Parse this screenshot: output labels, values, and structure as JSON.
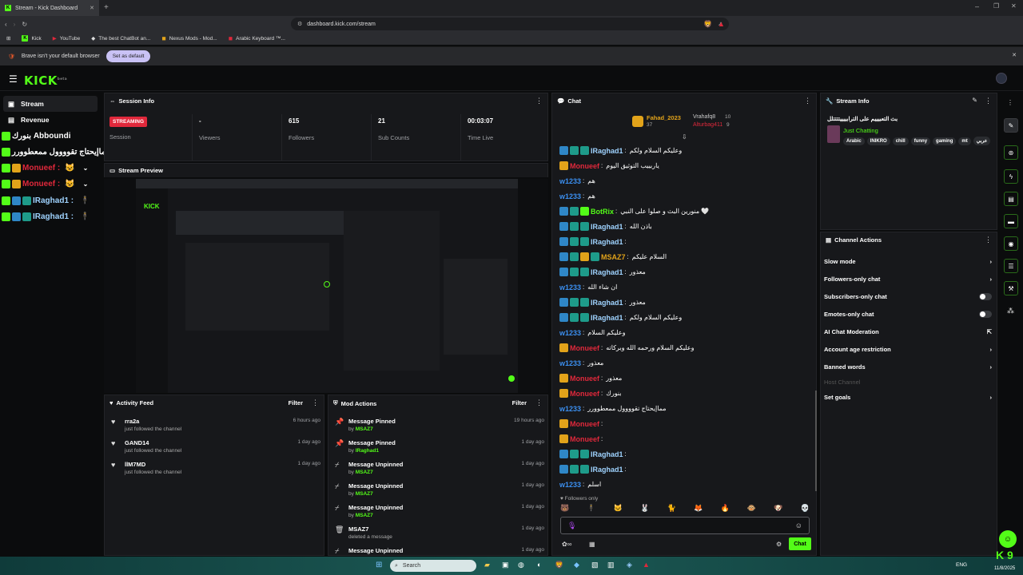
{
  "browser": {
    "tab_title": "Stream - Kick Dashboard",
    "url": "dashboard.kick.com/stream",
    "bookmarks": [
      "Kick",
      "YouTube",
      "The best ChatBot an...",
      "Nexus Mods - Mod...",
      "Arabic Keyboard ™..."
    ],
    "notice_text": "Brave isn't your default browser",
    "notice_button": "Set as default"
  },
  "header": {
    "logo": "KICK",
    "logo_sup": "beta"
  },
  "sidebar": {
    "items": [
      {
        "label": "Stream"
      },
      {
        "label": "Revenue"
      }
    ],
    "overlay_lines": [
      {
        "text": "بنورك Abboundi",
        "color": "#ffffff"
      },
      {
        "text": "مماإيحتاج تقوووول ممعطوورر : w1233",
        "color": "#ffffff"
      },
      {
        "text": "Monueef :",
        "color": "#e0283b"
      },
      {
        "text": "Monueef :",
        "color": "#e0283b"
      },
      {
        "text": "IRaghad1 :",
        "color": "#9fd3ff"
      },
      {
        "text": "IRaghad1 :",
        "color": "#9fd3ff"
      }
    ]
  },
  "session": {
    "title": "Session Info",
    "status": "STREAMING",
    "stats": [
      {
        "value": "",
        "label": "Session"
      },
      {
        "value": "-",
        "label": "Viewers"
      },
      {
        "value": "615",
        "label": "Followers"
      },
      {
        "value": "21",
        "label": "Sub Counts"
      },
      {
        "value": "00:03:07",
        "label": "Time Live"
      }
    ]
  },
  "preview": {
    "title": "Stream Preview"
  },
  "activity": {
    "title": "Activity Feed",
    "filter": "Filter",
    "items": [
      {
        "name": "rra2a",
        "desc": "just followed the channel",
        "time": "6 hours ago"
      },
      {
        "name": "GAND14",
        "desc": "just followed the channel",
        "time": "1 day ago"
      },
      {
        "name": "llM7MD",
        "desc": "just followed the channel",
        "time": "1 day ago"
      }
    ]
  },
  "mod_actions": {
    "title": "Mod Actions",
    "filter": "Filter",
    "items": [
      {
        "action": "Message Pinned",
        "by": "by",
        "user": "MSAZ7",
        "time": "19 hours ago",
        "icon": "pin-icon"
      },
      {
        "action": "Message Pinned",
        "by": "by",
        "user": "IRaghad1",
        "time": "1 day ago",
        "icon": "pin-icon"
      },
      {
        "action": "Message Unpinned",
        "by": "by",
        "user": "MSAZ7",
        "time": "1 day ago",
        "icon": "unpin-icon"
      },
      {
        "action": "Message Unpinned",
        "by": "by",
        "user": "MSAZ7",
        "time": "1 day ago",
        "icon": "unpin-icon"
      },
      {
        "action": "Message Unpinned",
        "by": "by",
        "user": "MSAZ7",
        "time": "1 day ago",
        "icon": "unpin-icon"
      },
      {
        "action": "MSAZ7",
        "by": "deleted a message",
        "user": "",
        "time": "1 day ago",
        "icon": "trash-icon"
      },
      {
        "action": "Message Unpinned",
        "by": "",
        "user": "",
        "time": "1 day ago",
        "icon": "unpin-icon"
      }
    ]
  },
  "chat": {
    "title": "Chat",
    "top_users": [
      {
        "name": "Fahad_2023",
        "count": "37"
      },
      {
        "name": "Vrahafq8",
        "count": "10"
      },
      {
        "name": "Alturbag411",
        "count": "9"
      }
    ],
    "messages": [
      {
        "user": "IRaghad1",
        "cls": "u-raghad",
        "text": "وعليكم السلام ولكم",
        "badges": "3"
      },
      {
        "user": "Monueef",
        "cls": "u-monu",
        "text": "ياربييب التوثيق اليوم",
        "badges": "1"
      },
      {
        "user": "w1233",
        "cls": "u-w",
        "text": "هم",
        "badges": "0"
      },
      {
        "user": "w1233",
        "cls": "u-w",
        "text": "هم",
        "badges": "0"
      },
      {
        "user": "BotRix",
        "cls": "u-botrix",
        "text": "منورين البث و صلوا على النبي 🤍",
        "badges": "2"
      },
      {
        "user": "IRaghad1",
        "cls": "u-raghad",
        "text": "باذن الله",
        "badges": "3"
      },
      {
        "user": "IRaghad1",
        "cls": "u-raghad",
        "text": "",
        "badges": "3"
      },
      {
        "user": "MSAZ7",
        "cls": "u-msaz",
        "text": "السلام عليكم",
        "badges": "4"
      },
      {
        "user": "IRaghad1",
        "cls": "u-raghad",
        "text": "معذور",
        "badges": "3"
      },
      {
        "user": "w1233",
        "cls": "u-w",
        "text": "ان شاء الله",
        "badges": "0"
      },
      {
        "user": "IRaghad1",
        "cls": "u-raghad",
        "text": "معذور",
        "badges": "3"
      },
      {
        "user": "IRaghad1",
        "cls": "u-raghad",
        "text": "وعليكم السلام ولكم",
        "badges": "3"
      },
      {
        "user": "w1233",
        "cls": "u-w",
        "text": "وعليكم السلام",
        "badges": "0"
      },
      {
        "user": "Monueef",
        "cls": "u-monu",
        "text": "وعليكم السلام ورحمه الله وبركاته",
        "badges": "1"
      },
      {
        "user": "w1233",
        "cls": "u-w",
        "text": "معذور",
        "badges": "0"
      },
      {
        "user": "Monueef",
        "cls": "u-monu",
        "text": "معذور",
        "badges": "1"
      },
      {
        "user": "Monueef",
        "cls": "u-monu",
        "text": "بنورك",
        "badges": "1"
      },
      {
        "user": "w1233",
        "cls": "u-w",
        "text": "مماإيحتاج تقوووول ممعطوورر",
        "badges": "0"
      },
      {
        "user": "Monueef",
        "cls": "u-monu",
        "text": "",
        "badges": "1"
      },
      {
        "user": "Monueef",
        "cls": "u-monu",
        "text": "",
        "badges": "1"
      },
      {
        "user": "IRaghad1",
        "cls": "u-raghad",
        "text": "",
        "badges": "3"
      },
      {
        "user": "IRaghad1",
        "cls": "u-raghad",
        "text": "",
        "badges": "3"
      },
      {
        "user": "w1233",
        "cls": "u-w",
        "text": "اسلم",
        "badges": "0"
      }
    ],
    "followers_only": "Followers only",
    "send_label": "Chat"
  },
  "stream_info": {
    "title": "Stream Info",
    "stream_title": "بث التعبيييم على الترابييييتتتتلل",
    "category": "Just Chatting",
    "tags": [
      "Arabic",
      "INIKRO",
      "chill",
      "funny",
      "gaming",
      "mt",
      "عربي"
    ]
  },
  "channel_actions": {
    "title": "Channel Actions",
    "items": [
      {
        "label": "Slow mode",
        "control": "chevron"
      },
      {
        "label": "Followers-only chat",
        "control": "chevron"
      },
      {
        "label": "Subscribers-only chat",
        "control": "toggle"
      },
      {
        "label": "Emotes-only chat",
        "control": "toggle"
      },
      {
        "label": "AI Chat Moderation",
        "control": "external"
      },
      {
        "label": "Account age restriction",
        "control": "chevron"
      },
      {
        "label": "Banned words",
        "control": "chevron"
      },
      {
        "label": "Host Channel",
        "control": "none",
        "muted": true
      },
      {
        "label": "Set goals",
        "control": "chevron"
      }
    ]
  },
  "taskbar": {
    "search_placeholder": "Search",
    "lang": "ENG",
    "date": "11/8/2025"
  },
  "colors": {
    "accent": "#53fc18",
    "live": "#e0283b"
  }
}
